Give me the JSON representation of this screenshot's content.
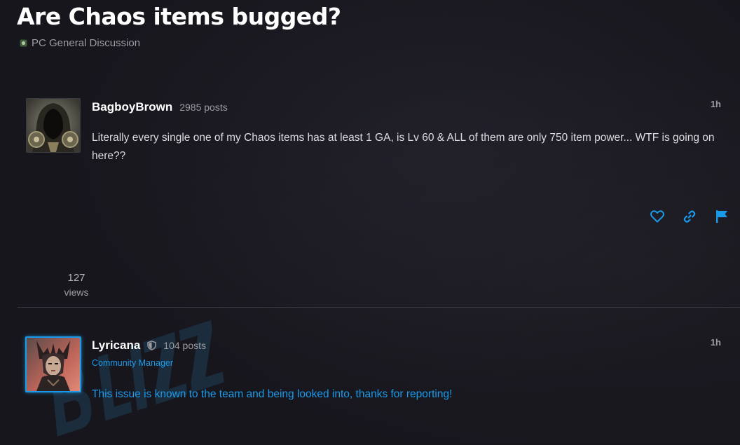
{
  "topic": {
    "title": "Are Chaos items bugged?",
    "category": "PC General Discussion"
  },
  "posts": [
    {
      "author": "BagboyBrown",
      "post_count": "2985 posts",
      "time": "1h",
      "body": "Literally every single one of my Chaos items has at least 1 GA, is Lv 60 & ALL of them are only 750 item power... WTF is going on here??"
    },
    {
      "author": "Lyricana",
      "post_count": "104 posts",
      "role": "Community Manager",
      "time": "1h",
      "body": "This issue is known to the team and being looked into, thanks for reporting!"
    }
  ],
  "stats": {
    "views_count": "127",
    "views_label": "views"
  },
  "icons": {
    "like": "heart-icon",
    "share": "link-icon",
    "flag": "flag-icon",
    "staff": "shield-icon"
  },
  "colors": {
    "accent": "#1a9bea",
    "background": "#17161d",
    "muted_text": "#9c9ca2"
  }
}
